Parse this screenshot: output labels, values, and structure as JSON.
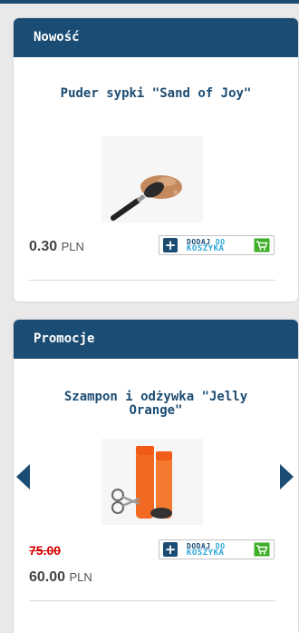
{
  "new_box": {
    "heading": "Nowość",
    "product_title": "Puder sypki \"Sand of Joy\"",
    "price_value": "0.30",
    "price_currency": "PLN",
    "cart_button": {
      "line1_a": "DODAJ",
      "line1_b": "DO",
      "line2": "KOSZYKA"
    }
  },
  "promo_box": {
    "heading": "Promocje",
    "product_title": "Szampon i odżywka \"Jelly Orange\"",
    "old_price": "75.00",
    "price_value": "60.00",
    "price_currency": "PLN",
    "cart_button": {
      "line1_a": "DODAJ",
      "line1_b": "DO",
      "line2": "KOSZYKA"
    }
  },
  "colors": {
    "brand": "#1b4c73",
    "accent": "#2aa8d8",
    "cart_green": "#3fae29",
    "old_price": "#d40000"
  },
  "icons": {
    "carousel_prev": "triangle-left-icon",
    "carousel_next": "triangle-right-icon",
    "cart": "cart-icon",
    "add": "plus-icon"
  }
}
